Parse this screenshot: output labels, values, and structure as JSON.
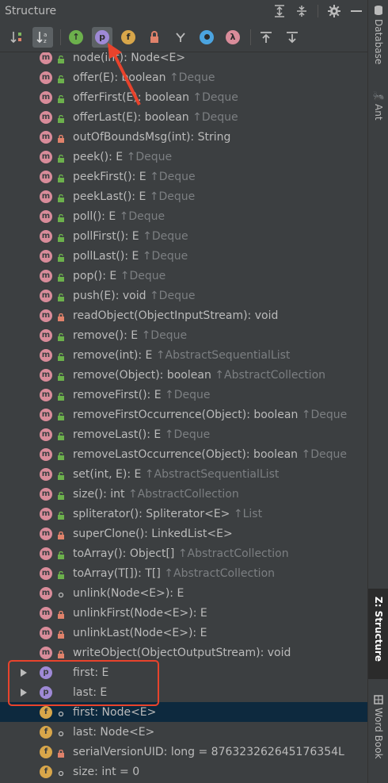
{
  "header": {
    "title": "Structure"
  },
  "members": [
    {
      "badge": "m",
      "vis": "public",
      "name": "node(int): Node<E>",
      "inherit": ""
    },
    {
      "badge": "m",
      "vis": "public",
      "name": "offer(E): boolean ",
      "inherit": "↑Deque"
    },
    {
      "badge": "m",
      "vis": "public",
      "name": "offerFirst(E): boolean ",
      "inherit": "↑Deque"
    },
    {
      "badge": "m",
      "vis": "public",
      "name": "offerLast(E): boolean ",
      "inherit": "↑Deque"
    },
    {
      "badge": "m",
      "vis": "private",
      "name": "outOfBoundsMsg(int): String",
      "inherit": ""
    },
    {
      "badge": "m",
      "vis": "public",
      "name": "peek(): E ",
      "inherit": "↑Deque"
    },
    {
      "badge": "m",
      "vis": "public",
      "name": "peekFirst(): E ",
      "inherit": "↑Deque"
    },
    {
      "badge": "m",
      "vis": "public",
      "name": "peekLast(): E ",
      "inherit": "↑Deque"
    },
    {
      "badge": "m",
      "vis": "public",
      "name": "poll(): E ",
      "inherit": "↑Deque"
    },
    {
      "badge": "m",
      "vis": "public",
      "name": "pollFirst(): E ",
      "inherit": "↑Deque"
    },
    {
      "badge": "m",
      "vis": "public",
      "name": "pollLast(): E ",
      "inherit": "↑Deque"
    },
    {
      "badge": "m",
      "vis": "public",
      "name": "pop(): E ",
      "inherit": "↑Deque"
    },
    {
      "badge": "m",
      "vis": "public",
      "name": "push(E): void ",
      "inherit": "↑Deque"
    },
    {
      "badge": "m",
      "vis": "private",
      "name": "readObject(ObjectInputStream): void",
      "inherit": ""
    },
    {
      "badge": "m",
      "vis": "public",
      "name": "remove(): E ",
      "inherit": "↑Deque"
    },
    {
      "badge": "m",
      "vis": "public",
      "name": "remove(int): E ",
      "inherit": "↑AbstractSequentialList"
    },
    {
      "badge": "m",
      "vis": "public",
      "name": "remove(Object): boolean ",
      "inherit": "↑AbstractCollection"
    },
    {
      "badge": "m",
      "vis": "public",
      "name": "removeFirst(): E ",
      "inherit": "↑Deque"
    },
    {
      "badge": "m",
      "vis": "public",
      "name": "removeFirstOccurrence(Object): boolean ",
      "inherit": "↑Deque"
    },
    {
      "badge": "m",
      "vis": "public",
      "name": "removeLast(): E ",
      "inherit": "↑Deque"
    },
    {
      "badge": "m",
      "vis": "public",
      "name": "removeLastOccurrence(Object): boolean ",
      "inherit": "↑Deque"
    },
    {
      "badge": "m",
      "vis": "public",
      "name": "set(int, E): E ",
      "inherit": "↑AbstractSequentialList"
    },
    {
      "badge": "m",
      "vis": "public",
      "name": "size(): int ",
      "inherit": "↑AbstractCollection"
    },
    {
      "badge": "m",
      "vis": "public",
      "name": "spliterator(): Spliterator<E> ",
      "inherit": "↑List"
    },
    {
      "badge": "m",
      "vis": "private",
      "name": "superClone(): LinkedList<E>",
      "inherit": ""
    },
    {
      "badge": "m",
      "vis": "public",
      "name": "toArray(): Object[] ",
      "inherit": "↑AbstractCollection"
    },
    {
      "badge": "m",
      "vis": "public",
      "name": "toArray(T[]): T[] ",
      "inherit": "↑AbstractCollection"
    },
    {
      "badge": "m",
      "vis": "package",
      "name": "unlink(Node<E>): E",
      "inherit": ""
    },
    {
      "badge": "m",
      "vis": "private",
      "name": "unlinkFirst(Node<E>): E",
      "inherit": ""
    },
    {
      "badge": "m",
      "vis": "private",
      "name": "unlinkLast(Node<E>): E",
      "inherit": ""
    },
    {
      "badge": "m",
      "vis": "private",
      "name": "writeObject(ObjectOutputStream): void",
      "inherit": ""
    },
    {
      "badge": "p",
      "vis": "none",
      "arrow": true,
      "name": "first: E",
      "inherit": ""
    },
    {
      "badge": "p",
      "vis": "none",
      "arrow": true,
      "name": "last: E",
      "inherit": ""
    },
    {
      "badge": "f",
      "vis": "package",
      "name": "first: Node<E>",
      "inherit": "",
      "selected": true
    },
    {
      "badge": "f",
      "vis": "package",
      "name": "last: Node<E>",
      "inherit": ""
    },
    {
      "badge": "f",
      "vis": "private",
      "name": "serialVersionUID: long = 876323262645176354L",
      "inherit": ""
    },
    {
      "badge": "f",
      "vis": "package",
      "name": "size: int = 0",
      "inherit": ""
    }
  ],
  "sidebar": {
    "tabs": [
      {
        "label": "Database"
      },
      {
        "label": "Ant"
      },
      {
        "label": "Z: Structure"
      },
      {
        "label": "Word Book"
      }
    ]
  },
  "colors": {
    "accent": "#e8432c",
    "selection": "#0d293e",
    "background": "#3c3f41"
  }
}
